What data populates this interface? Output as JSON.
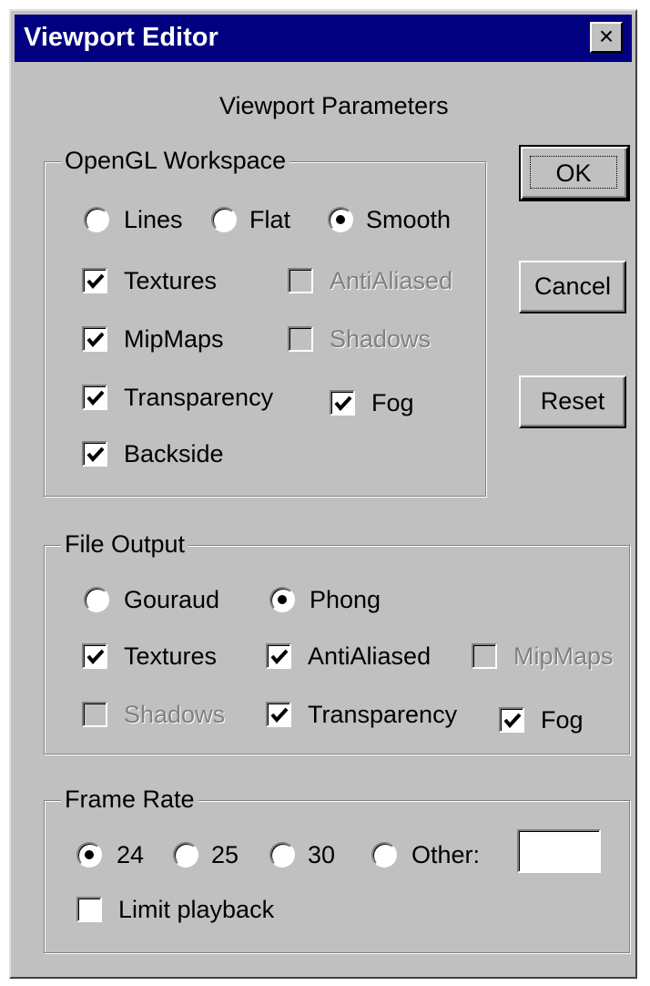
{
  "window": {
    "title": "Viewport Editor",
    "close_label": "×",
    "heading": "Viewport Parameters"
  },
  "buttons": {
    "ok": "OK",
    "cancel": "Cancel",
    "reset": "Reset"
  },
  "opengl": {
    "legend": "OpenGL Workspace",
    "render_mode": {
      "options": [
        "Lines",
        "Flat",
        "Smooth"
      ],
      "selected": "Smooth"
    },
    "textures": {
      "label": "Textures",
      "checked": true,
      "enabled": true
    },
    "antialiased": {
      "label": "AntiAliased",
      "checked": false,
      "enabled": false
    },
    "mipmaps": {
      "label": "MipMaps",
      "checked": true,
      "enabled": true
    },
    "shadows": {
      "label": "Shadows",
      "checked": false,
      "enabled": false
    },
    "transparency": {
      "label": "Transparency",
      "checked": true,
      "enabled": true
    },
    "fog": {
      "label": "Fog",
      "checked": true,
      "enabled": true
    },
    "backside": {
      "label": "Backside",
      "checked": true,
      "enabled": true
    }
  },
  "file_output": {
    "legend": "File Output",
    "shading": {
      "options": [
        "Gouraud",
        "Phong"
      ],
      "selected": "Phong"
    },
    "textures": {
      "label": "Textures",
      "checked": true,
      "enabled": true
    },
    "antialiased": {
      "label": "AntiAliased",
      "checked": true,
      "enabled": true
    },
    "mipmaps": {
      "label": "MipMaps",
      "checked": false,
      "enabled": false
    },
    "shadows": {
      "label": "Shadows",
      "checked": false,
      "enabled": false
    },
    "transparency": {
      "label": "Transparency",
      "checked": true,
      "enabled": true
    },
    "fog": {
      "label": "Fog",
      "checked": true,
      "enabled": true
    }
  },
  "frame_rate": {
    "legend": "Frame Rate",
    "options": [
      "24",
      "25",
      "30",
      "Other:"
    ],
    "selected": "24",
    "other_value": "",
    "limit_playback": {
      "label": "Limit playback",
      "checked": false,
      "enabled": true
    }
  },
  "colors": {
    "face": "#c0c0c0",
    "titlebar": "#000080",
    "disabled_text": "#808080"
  }
}
